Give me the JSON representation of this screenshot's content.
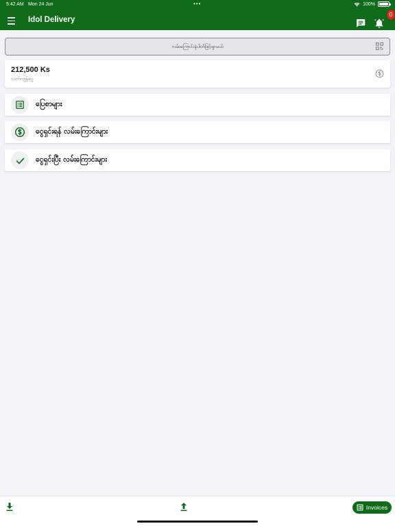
{
  "status_bar": {
    "time": "5:42 AM",
    "date": "Mon 24 Jun",
    "dots": "•••",
    "battery": "100%"
  },
  "app_bar": {
    "title": "Idol Delivery",
    "notification_count": "0",
    "icons": [
      "menu-icon",
      "chat-icon",
      "bell-icon"
    ]
  },
  "scan": {
    "placeholder": "လမ်းကြောင်းနံပါတ်ဖြင့်ရှာမယ်",
    "icon": "qr-scan-icon"
  },
  "balance": {
    "amount": "212,500 Ks",
    "label": "လက်ကျန်ငွေ",
    "icon": "dollar-outline-icon"
  },
  "nav_items": [
    {
      "label": "ပြေစာများ",
      "icon": "receipt-icon"
    },
    {
      "label": "ငွေရှင်းရန် လမ်းကြောင်းများ",
      "icon": "dollar-circle-icon"
    },
    {
      "label": "ငွေရှင်းပြီး လမ်းကြောင်းများ",
      "icon": "check-icon"
    }
  ],
  "bottom_bar": {
    "download_icon": "download-icon",
    "upload_icon": "upload-icon",
    "invoices_label": "Invoices"
  },
  "colors": {
    "brand_green": "#0f6a1a",
    "badge_red": "#d93025",
    "background": "#f2f2f7"
  }
}
